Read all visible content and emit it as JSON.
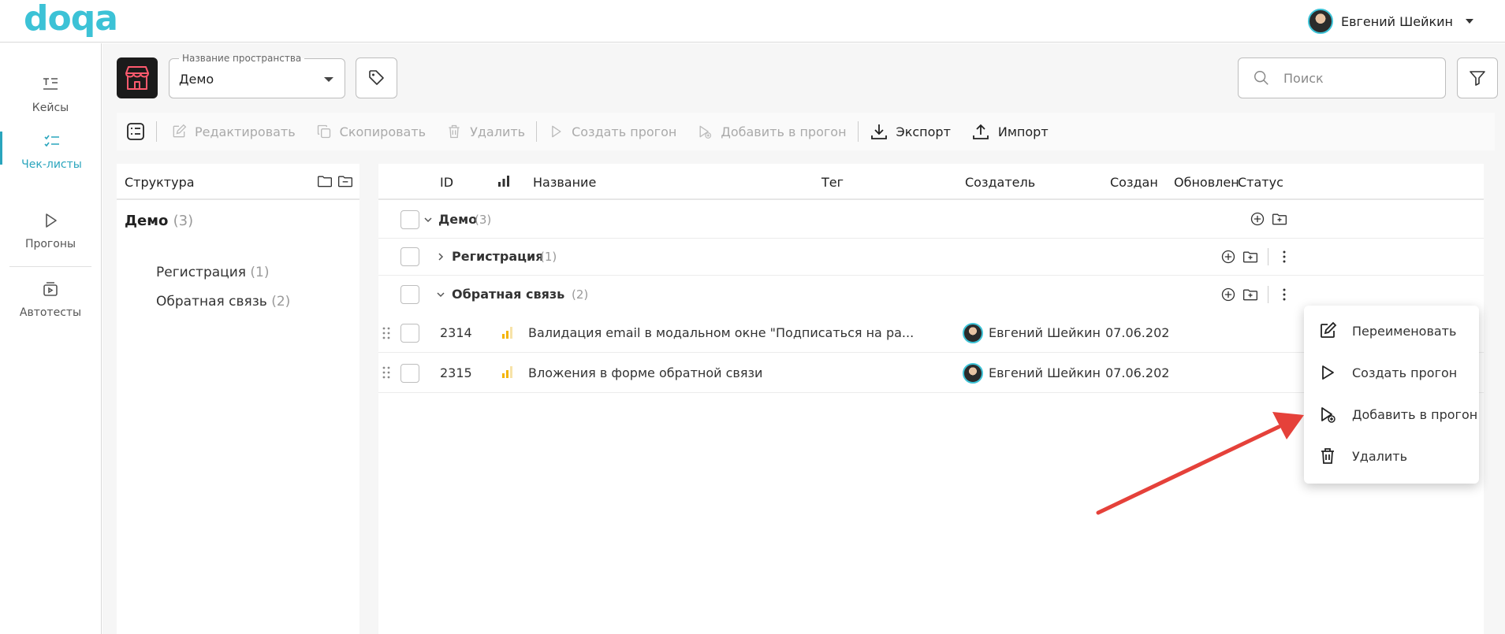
{
  "app": {
    "logo": "doqa"
  },
  "user": {
    "name": "Евгений Шейкин"
  },
  "sidebar": {
    "items": [
      {
        "label": "Кейсы",
        "icon": "cases-icon"
      },
      {
        "label": "Чек-листы",
        "icon": "checklist-icon",
        "active": true
      },
      {
        "label": "Прогоны",
        "icon": "play-icon"
      },
      {
        "label": "Автотесты",
        "icon": "autotest-icon"
      }
    ]
  },
  "space": {
    "label": "Название пространства",
    "value": "Демо"
  },
  "search": {
    "placeholder": "Поиск"
  },
  "toolbar": {
    "edit": "Редактировать",
    "copy": "Скопировать",
    "delete": "Удалить",
    "create_run": "Создать прогон",
    "add_to_run": "Добавить в прогон",
    "export": "Экспорт",
    "import": "Импорт"
  },
  "structure": {
    "title": "Структура",
    "root": {
      "name": "Демо",
      "count": "(3)"
    },
    "children": [
      {
        "name": "Регистрация",
        "count": "(1)"
      },
      {
        "name": "Обратная связь",
        "count": "(2)"
      }
    ]
  },
  "table": {
    "columns": {
      "id": "ID",
      "name": "Название",
      "tag": "Тег",
      "creator": "Создатель",
      "created": "Создан",
      "updated": "Обновлен",
      "status": "Статус"
    },
    "groups": [
      {
        "name": "Демо",
        "count": "(3)"
      },
      {
        "name": "Регистрация",
        "count": "(1)"
      },
      {
        "name": "Обратная связь",
        "count": "(2)"
      }
    ],
    "rows": [
      {
        "id": "2314",
        "name": "Валидация email в модальном окне \"Подписаться на ра...",
        "creator": "Евгений Шейкин",
        "created": "07.06.202"
      },
      {
        "id": "2315",
        "name": "Вложения в форме обратной связи",
        "creator": "Евгений Шейкин",
        "created": "07.06.202"
      }
    ]
  },
  "context_menu": {
    "rename": "Переименовать",
    "create_run": "Создать прогон",
    "add_to_run": "Добавить в прогон",
    "delete": "Удалить"
  },
  "colors": {
    "accent": "#3cc2d6",
    "priority": "#f4b400",
    "annotation_arrow": "#e5413a"
  }
}
